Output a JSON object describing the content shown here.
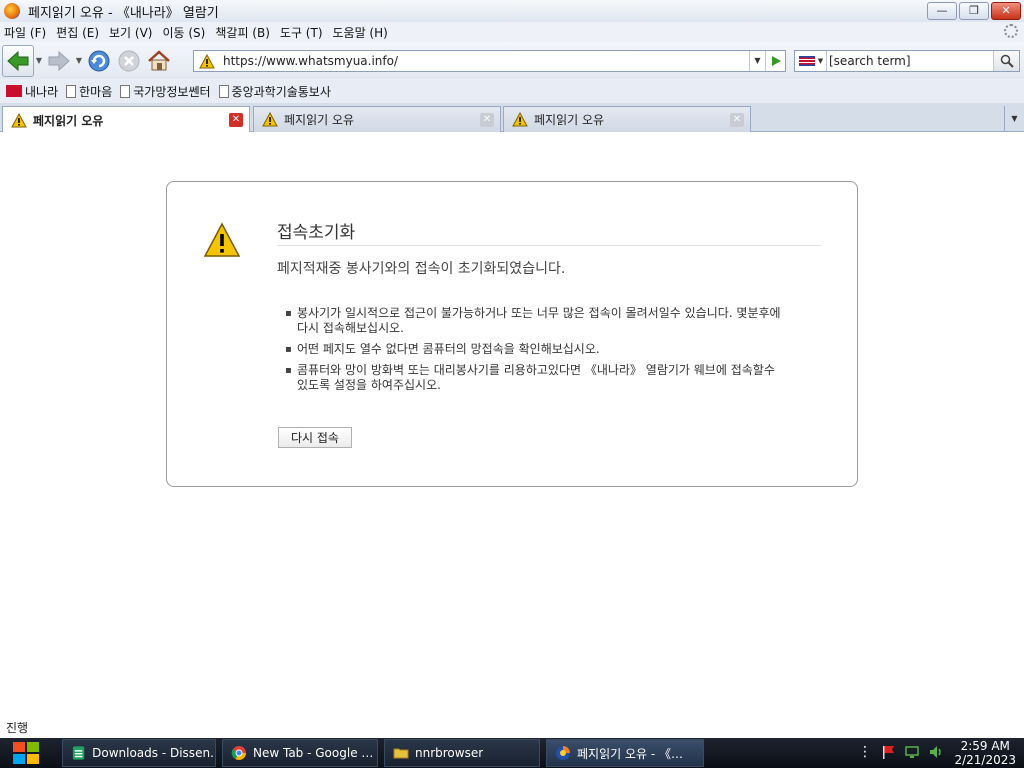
{
  "window": {
    "title": "페지읽기 오유 - 《내나라》 열람기"
  },
  "menu": {
    "items": [
      "파일 (F)",
      "편집 (E)",
      "보기 (V)",
      "이동 (S)",
      "책갈피 (B)",
      "도구 (T)",
      "도움말 (H)"
    ]
  },
  "navigation": {
    "url": "https://www.whatsmyua.info/",
    "search_query": "[search term]"
  },
  "bookmarks": [
    {
      "label": "내나라",
      "icon": "brand-icon"
    },
    {
      "label": "한마음",
      "icon": "page-icon"
    },
    {
      "label": "국가망정보쎈터",
      "icon": "page-icon"
    },
    {
      "label": "중앙과학기술통보사",
      "icon": "page-icon"
    }
  ],
  "tabs": [
    {
      "label": "페지읽기 오유"
    },
    {
      "label": "페지읽기 오유"
    },
    {
      "label": "페지읽기 오유"
    }
  ],
  "error": {
    "title": "접속초기화",
    "subtitle": "페지적재중 봉사기와의 접속이 초기화되였습니다.",
    "bullets": [
      "봉사기가 일시적으로 접근이 불가능하거나 또는 너무 많은 접속이 몰려서일수 있습니다. 몇분후에 다시 접속해보십시오.",
      "어떤 페지도 열수 없다면 콤퓨터의 망접속을 확인해보십시오.",
      "콤퓨터와 망이 방화벽 또는 대리봉사기를 리용하고있다면 《내나라》 열람기가 웨브에 접속할수 있도록 설정을 하여주십시오."
    ],
    "retry_label": "다시 접속"
  },
  "status": {
    "text": "진행"
  },
  "taskbar": {
    "tasks": [
      {
        "label": "Downloads - Dissen…",
        "icon": "sheets-icon"
      },
      {
        "label": "New Tab - Google …",
        "icon": "chrome-icon"
      },
      {
        "label": "nnrbrowser",
        "icon": "folder-icon"
      },
      {
        "label": "페지읽기 오유 - 《…",
        "icon": "browser-icon"
      }
    ],
    "time": "2:59 AM",
    "date": "2/21/2023"
  },
  "colors": {
    "accent": "#2a64c8",
    "warning": "#f5c400",
    "close_red": "#d03028"
  }
}
